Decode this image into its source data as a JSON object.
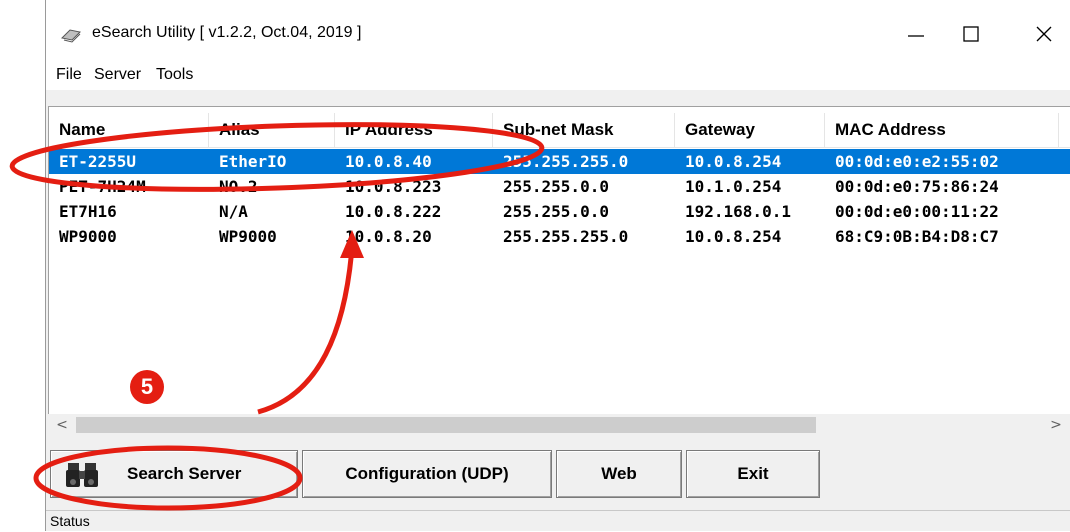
{
  "window": {
    "title": "eSearch Utility [ v1.2.2, Oct.04, 2019 ]",
    "controls": {
      "minimize": "—",
      "maximize": "☐",
      "close": "✕"
    }
  },
  "menu": {
    "items": [
      "File",
      "Server",
      "Tools"
    ]
  },
  "table": {
    "columns": [
      "Name",
      "Alias",
      "IP Address",
      "Sub-net Mask",
      "Gateway",
      "MAC Address"
    ],
    "rows": [
      [
        "ET-2255U",
        "EtherIO",
        "10.0.8.40",
        "255.255.255.0",
        "10.0.8.254",
        "00:0d:e0:e2:55:02"
      ],
      [
        "PET-7H24M",
        "NO.2",
        "10.0.8.223",
        "255.255.0.0",
        "10.1.0.254",
        "00:0d:e0:75:86:24"
      ],
      [
        "ET7H16",
        "N/A",
        "10.0.8.222",
        "255.255.0.0",
        "192.168.0.1",
        "00:0d:e0:00:11:22"
      ],
      [
        "WP9000",
        "WP9000",
        "10.0.8.20",
        "255.255.255.0",
        "10.0.8.254",
        "68:C9:0B:B4:D8:C7"
      ]
    ],
    "selected_row": 0
  },
  "scrollbar": {
    "left_arrow": "<",
    "right_arrow": ">"
  },
  "buttons": {
    "search": "Search Server",
    "config": "Configuration (UDP)",
    "web": "Web",
    "exit": "Exit"
  },
  "status": {
    "text": "Status"
  },
  "annotation": {
    "step": "5",
    "color": "#e41e12"
  },
  "colors": {
    "selection": "#0078d7",
    "annotation": "#e41e12"
  }
}
